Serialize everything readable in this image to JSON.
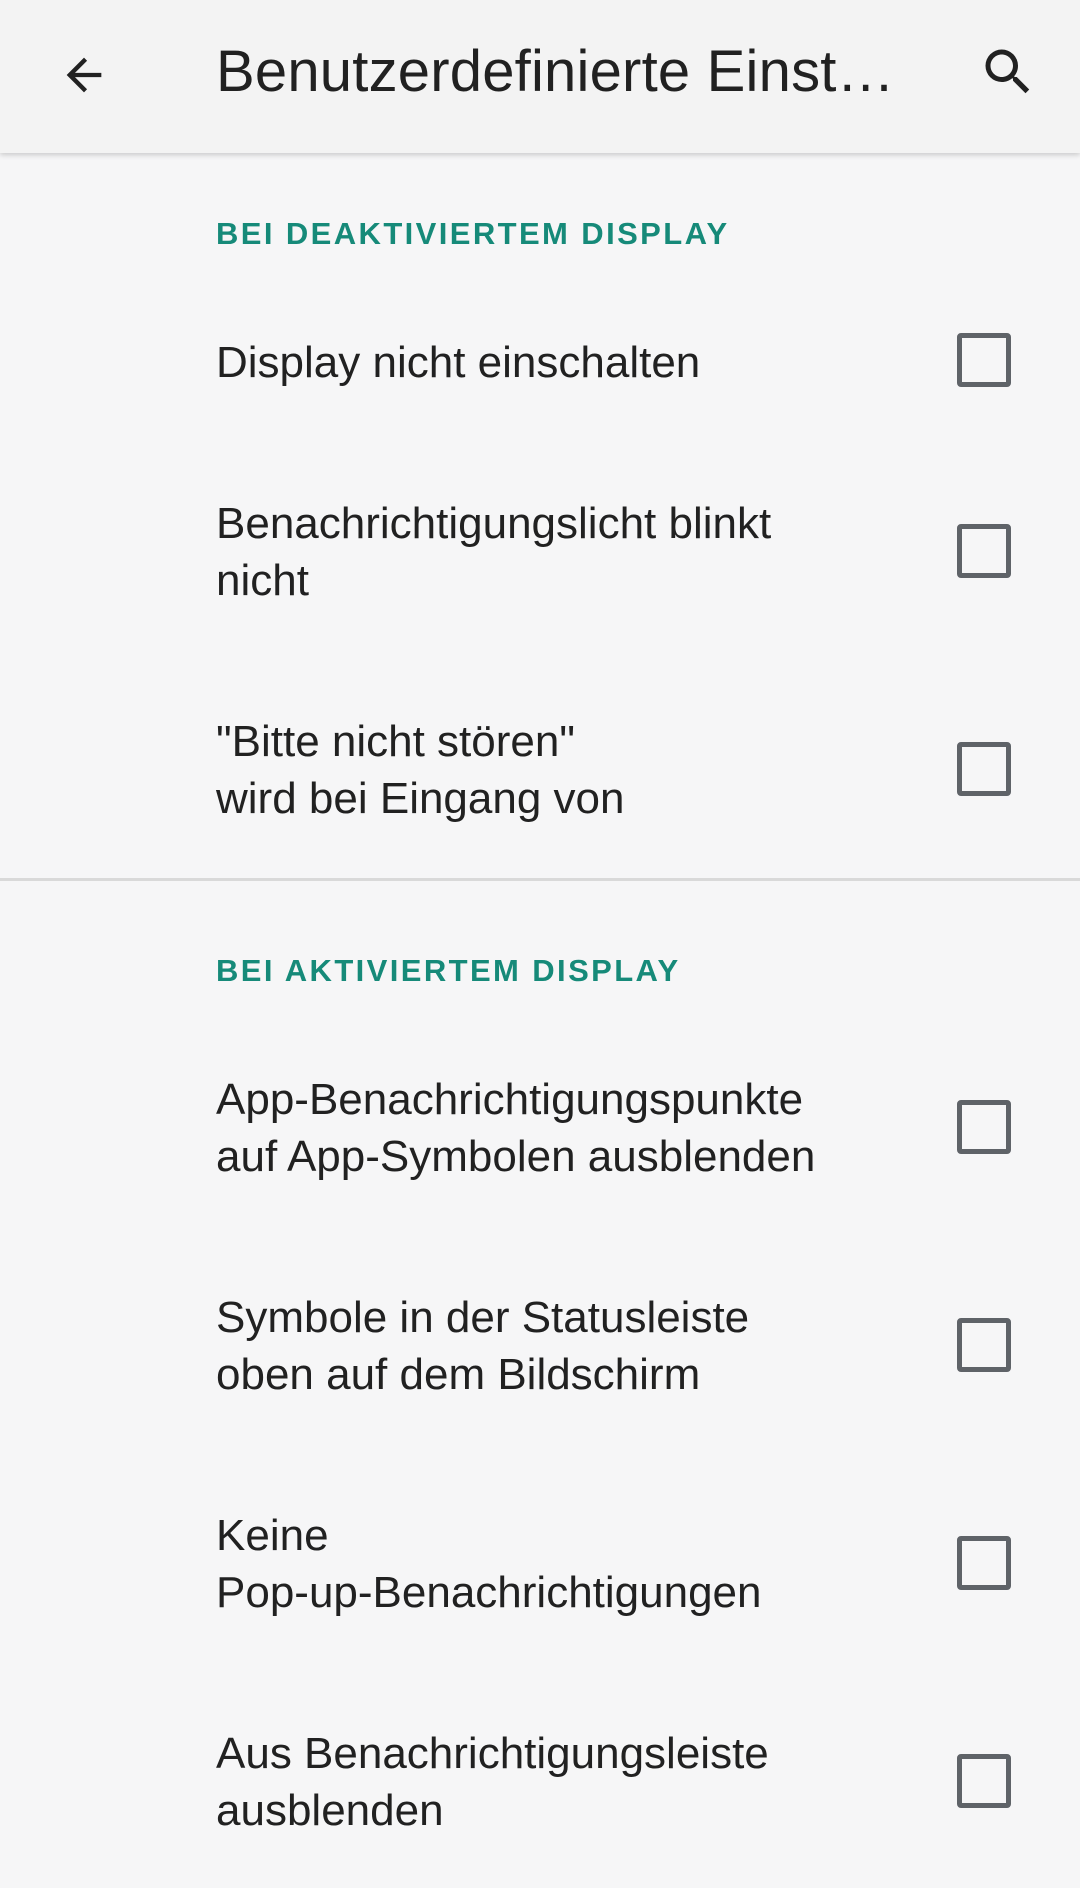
{
  "app_bar": {
    "title": "Benutzerdefinierte Einstellungen",
    "back_icon": "arrow-back-icon",
    "search_icon": "search-icon"
  },
  "sections": [
    {
      "header": "BEI DEAKTIVIERTEM DISPLAY",
      "items": [
        {
          "label": "Display nicht einschalten",
          "checked": false
        },
        {
          "label": "Benachrichtigungslicht blinkt\nnicht",
          "checked": false
        },
        {
          "label": "\"Bitte nicht stören\"\nwird bei Eingang von",
          "checked": false
        }
      ]
    },
    {
      "header": "BEI AKTIVIERTEM DISPLAY",
      "items": [
        {
          "label": "App-Benachrichtigungspunkte\nauf App-Symbolen ausblenden",
          "checked": false
        },
        {
          "label": "Symbole in der Statusleiste\noben auf dem Bildschirm",
          "checked": false
        },
        {
          "label": "Keine\nPop-up-Benachrichtigungen",
          "checked": false
        },
        {
          "label": "Aus Benachrichtigungsleiste\nausblenden",
          "checked": false
        }
      ]
    }
  ],
  "colors": {
    "accent": "#168a79",
    "text": "#212121",
    "checkbox_border": "#5f6368",
    "background": "#f6f6f7"
  }
}
